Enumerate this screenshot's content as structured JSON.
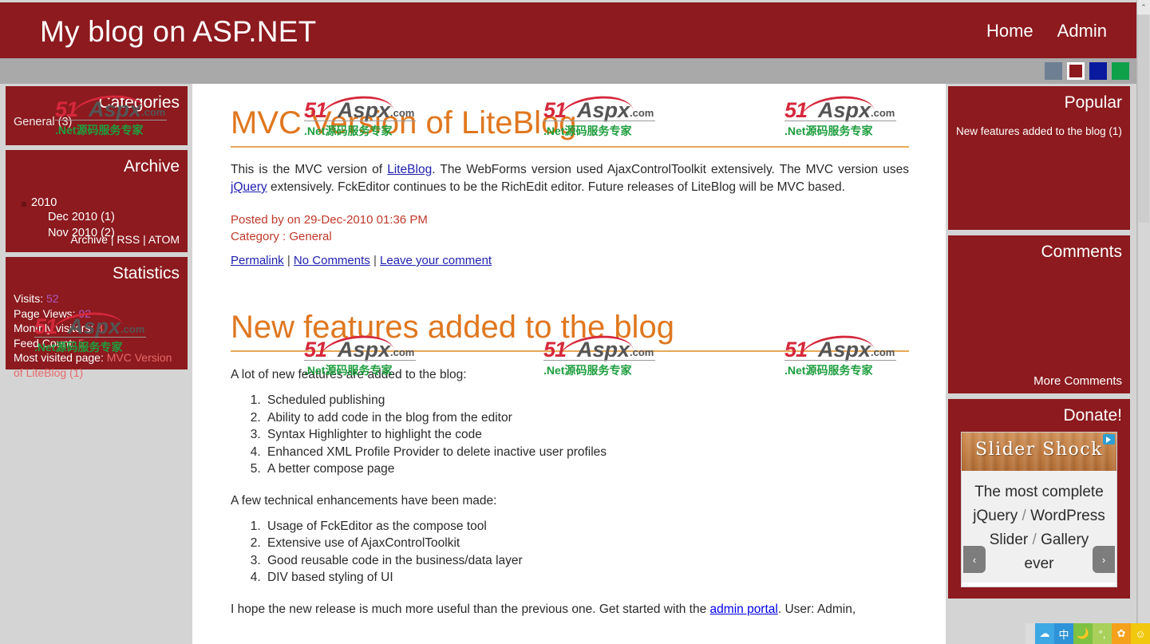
{
  "banner": {
    "title": "My blog on ASP.NET",
    "nav": [
      {
        "label": "Home"
      },
      {
        "label": "Admin"
      }
    ]
  },
  "theme_bar": {
    "swatches": [
      {
        "name": "slate",
        "color": "#6e7f93",
        "selected": false
      },
      {
        "name": "red",
        "color": "#8c1a1e",
        "selected": true
      },
      {
        "name": "blue",
        "color": "#0a1a9e",
        "selected": false
      },
      {
        "name": "green",
        "color": "#0fa04a",
        "selected": false
      }
    ]
  },
  "left_sidebar": {
    "categories": {
      "title": "Categories",
      "items": [
        {
          "label": "General (3)"
        }
      ]
    },
    "archive": {
      "title": "Archive",
      "year": "2010",
      "months": [
        {
          "label": "Dec 2010 (1)"
        },
        {
          "label": "Nov 2010 (2)"
        }
      ],
      "links": "Archive | RSS | ATOM"
    },
    "statistics": {
      "title": "Statistics",
      "visits_label": "Visits:",
      "visits_value": "52",
      "page_views_label": "Page Views:",
      "page_views_value": "92",
      "monthly_label": "Monthly visitors:",
      "monthly_value": "3",
      "feed_label": "Feed Count:",
      "feed_value": "5",
      "most_visited_label": "Most visited page:",
      "most_visited_value": "MVC Version of LiteBlog (1)"
    }
  },
  "posts": [
    {
      "title": "MVC Version of LiteBlog",
      "body_1": "This is the MVC version of ",
      "link_1": "LiteBlog",
      "body_2": ". The WebForms version used AjaxControlToolkit extensively. The MVC version uses ",
      "link_2": "jQuery",
      "body_3": " extensively. FckEditor continues to be the RichEdit editor. Future releases of LiteBlog will be MVC based.",
      "posted_by": "Posted by on 29-Dec-2010 01:36 PM",
      "category": "Category : General",
      "link_permalink": "Permalink",
      "link_comments": "No Comments",
      "link_leave": "Leave your comment",
      "sep": " | "
    },
    {
      "title": "New features added to the blog",
      "intro": "A lot of new features are added to the blog:",
      "features": [
        "Scheduled publishing",
        "Ability to add code in the blog from the editor",
        "Syntax Highlighter to highlight the code",
        "Enhanced XML Profile Provider to delete inactive user profiles",
        "A better compose page"
      ],
      "tech_intro": "A few technical enhancements have been made:",
      "tech": [
        "Usage of FckEditor as the compose tool",
        "Extensive use of AjaxControlToolkit",
        "Good reusable code in the business/data layer",
        "DIV based styling of UI"
      ],
      "closing_1": "I hope the new release is much more useful than the previous one. Get started with the ",
      "closing_link": "admin portal",
      "closing_2": ". User: Admin,"
    }
  ],
  "watermark": {
    "brand_num": "51",
    "brand_word": "Aspx",
    "brand_tld": ".com",
    "tagline": ".Net源码服务专家"
  },
  "right_sidebar": {
    "popular": {
      "title": "Popular",
      "items": [
        {
          "label": "New features added to the blog (1)"
        }
      ]
    },
    "comments": {
      "title": "Comments",
      "more_label": "More Comments"
    },
    "donate": {
      "title": "Donate!",
      "ad": {
        "brand": "Slider Shock",
        "line_1": "The most complete",
        "line_2a": "jQuery",
        "line_2sep": " / ",
        "line_2b": "WordPress",
        "line_3a": "Slider",
        "line_3sep": " / ",
        "line_3b": "Gallery",
        "line_4": "ever",
        "prev": "‹",
        "next": "›"
      }
    }
  },
  "scrollbar": {
    "up_arrow": "⌃"
  },
  "ime": {
    "tiles": [
      {
        "name": "cloud-icon",
        "glyph": "☁",
        "color": "#3ea8e5"
      },
      {
        "name": "chinese-mode-icon",
        "glyph": "中",
        "color": "#2f93d8"
      },
      {
        "name": "moon-icon",
        "glyph": "🌙",
        "color": "#7dc242"
      },
      {
        "name": "punctuation-icon",
        "glyph": "°,",
        "color": "#a8d05a"
      },
      {
        "name": "settings-gear-icon",
        "glyph": "✿",
        "color": "#f5a11b"
      },
      {
        "name": "emoji-icon",
        "glyph": "☺",
        "color": "#f2c80f"
      }
    ]
  }
}
